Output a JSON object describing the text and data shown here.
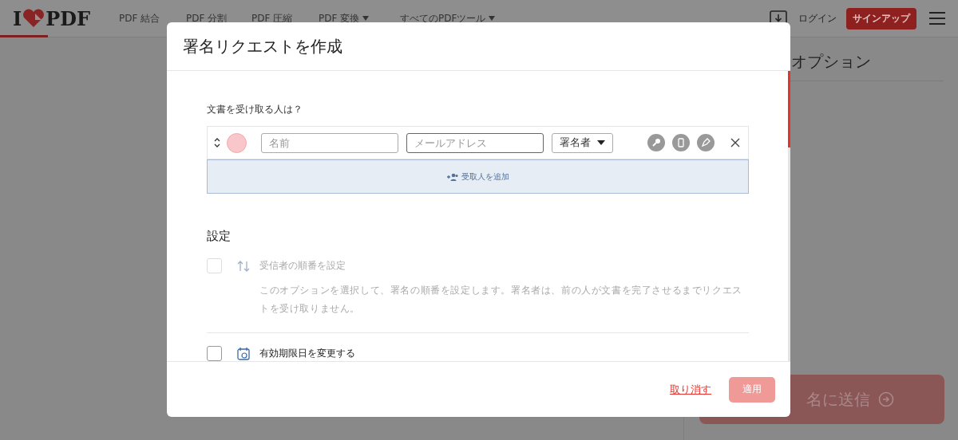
{
  "header": {
    "logo_left": "I",
    "logo_right": "PDF",
    "nav": [
      {
        "label": "PDF 結合",
        "dropdown": false
      },
      {
        "label": "PDF 分割",
        "dropdown": false
      },
      {
        "label": "PDF 圧縮",
        "dropdown": false
      },
      {
        "label": "PDF 変換",
        "dropdown": true
      },
      {
        "label": "すべてのPDFツール",
        "dropdown": true
      }
    ],
    "login": "ログイン",
    "signup": "サインアップ"
  },
  "side_panel": {
    "title": "オプション",
    "send_button": "名に送信"
  },
  "dialog": {
    "title": "署名リクエストを作成",
    "recipients_label": "文書を受け取る人は？",
    "recipients": [
      {
        "color": "#f9c6c9",
        "name_placeholder": "名前",
        "email_placeholder": "メールアドレス",
        "role": "署名者"
      }
    ],
    "add_recipient": "受取人を追加",
    "settings_title": "設定",
    "options": [
      {
        "kind": "order",
        "label": "受信者の順番を設定",
        "description": "このオプションを選択して、署名の順番を設定します。署名者は、前の人が文書を完了させるまでリクエストを受け取りません。",
        "checked": false,
        "disabled": true
      },
      {
        "kind": "expiry",
        "label": "有効期限日を変更する",
        "checked": false,
        "disabled": false
      }
    ],
    "cancel": "取り消す",
    "apply": "適用",
    "apply_disabled": true
  }
}
